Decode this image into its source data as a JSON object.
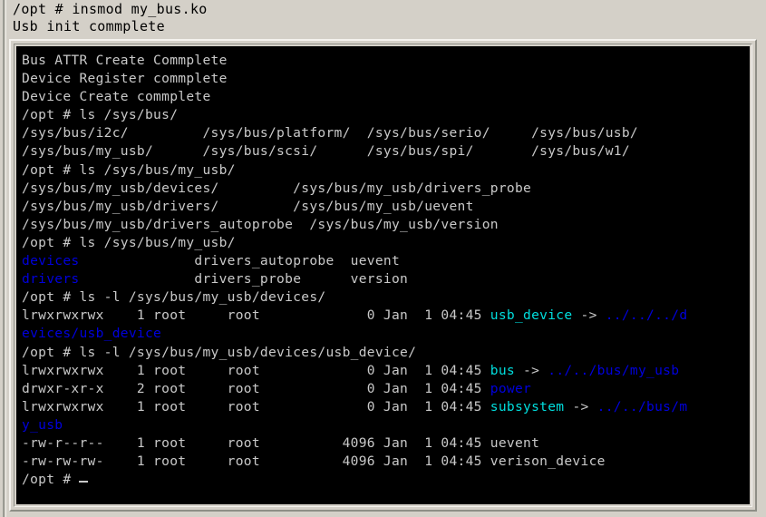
{
  "colors": {
    "window_bg": "#d4d0c8",
    "terminal_bg": "#000000",
    "terminal_fg": "#c9c9c9",
    "directory": "#0000dd",
    "symlink": "#00dede"
  },
  "header_console": {
    "name": "host-console-output",
    "lines": [
      "/opt # insmod my_bus.ko",
      "Usb init commplete"
    ]
  },
  "terminal": {
    "name": "serial-terminal",
    "prompt": "/opt # ",
    "lines": [
      {
        "segments": [
          {
            "text": "Bus ATTR Create Commplete",
            "color": "default"
          }
        ]
      },
      {
        "segments": [
          {
            "text": "Device Register commplete",
            "color": "default"
          }
        ]
      },
      {
        "segments": [
          {
            "text": "Device Create commplete",
            "color": "default"
          }
        ]
      },
      {
        "segments": [
          {
            "text": "/opt # ls /sys/bus/",
            "color": "default"
          }
        ]
      },
      {
        "segments": [
          {
            "text": "/sys/bus/i2c/         /sys/bus/platform/  /sys/bus/serio/     /sys/bus/usb/",
            "color": "default"
          }
        ]
      },
      {
        "segments": [
          {
            "text": "/sys/bus/my_usb/      /sys/bus/scsi/      /sys/bus/spi/       /sys/bus/w1/",
            "color": "default"
          }
        ]
      },
      {
        "segments": [
          {
            "text": "/opt # ls /sys/bus/my_usb/",
            "color": "default"
          }
        ]
      },
      {
        "segments": [
          {
            "text": "/sys/bus/my_usb/devices/         /sys/bus/my_usb/drivers_probe",
            "color": "default"
          }
        ]
      },
      {
        "segments": [
          {
            "text": "/sys/bus/my_usb/drivers/         /sys/bus/my_usb/uevent",
            "color": "default"
          }
        ]
      },
      {
        "segments": [
          {
            "text": "/sys/bus/my_usb/drivers_autoprobe  /sys/bus/my_usb/version",
            "color": "default"
          }
        ]
      },
      {
        "segments": [
          {
            "text": "/opt # ls /sys/bus/my_usb/",
            "color": "default"
          }
        ]
      },
      {
        "segments": [
          {
            "text": "devices",
            "color": "dir"
          },
          {
            "text": "              drivers_autoprobe  uevent",
            "color": "default"
          }
        ]
      },
      {
        "segments": [
          {
            "text": "drivers",
            "color": "dir"
          },
          {
            "text": "              drivers_probe      version",
            "color": "default"
          }
        ]
      },
      {
        "segments": [
          {
            "text": "/opt # ls -l /sys/bus/my_usb/devices/",
            "color": "default"
          }
        ]
      },
      {
        "segments": [
          {
            "text": "lrwxrwxrwx    1 root     root             0 Jan  1 04:45 ",
            "color": "default"
          },
          {
            "text": "usb_device",
            "color": "link"
          },
          {
            "text": " -> ",
            "color": "default"
          },
          {
            "text": "../../../d",
            "color": "dir"
          }
        ]
      },
      {
        "segments": [
          {
            "text": "evices/usb_device",
            "color": "dir"
          }
        ]
      },
      {
        "segments": [
          {
            "text": "/opt # ls -l /sys/bus/my_usb/devices/usb_device/",
            "color": "default"
          }
        ]
      },
      {
        "segments": [
          {
            "text": "lrwxrwxrwx    1 root     root             0 Jan  1 04:45 ",
            "color": "default"
          },
          {
            "text": "bus",
            "color": "link"
          },
          {
            "text": " -> ",
            "color": "default"
          },
          {
            "text": "../../bus/my_usb",
            "color": "dir"
          }
        ]
      },
      {
        "segments": [
          {
            "text": "drwxr-xr-x    2 root     root             0 Jan  1 04:45 ",
            "color": "default"
          },
          {
            "text": "power",
            "color": "dir"
          }
        ]
      },
      {
        "segments": [
          {
            "text": "lrwxrwxrwx    1 root     root             0 Jan  1 04:45 ",
            "color": "default"
          },
          {
            "text": "subsystem",
            "color": "link"
          },
          {
            "text": " -> ",
            "color": "default"
          },
          {
            "text": "../../bus/m",
            "color": "dir"
          }
        ]
      },
      {
        "segments": [
          {
            "text": "y_usb",
            "color": "dir"
          }
        ]
      },
      {
        "segments": [
          {
            "text": "-rw-r--r--    1 root     root          4096 Jan  1 04:45 uevent",
            "color": "default"
          }
        ]
      },
      {
        "segments": [
          {
            "text": "-rw-rw-rw-    1 root     root          4096 Jan  1 04:45 verison_device",
            "color": "default"
          }
        ]
      },
      {
        "segments": [
          {
            "text": "/opt # ",
            "color": "default"
          },
          {
            "text": "",
            "color": "cursor"
          }
        ]
      }
    ]
  }
}
